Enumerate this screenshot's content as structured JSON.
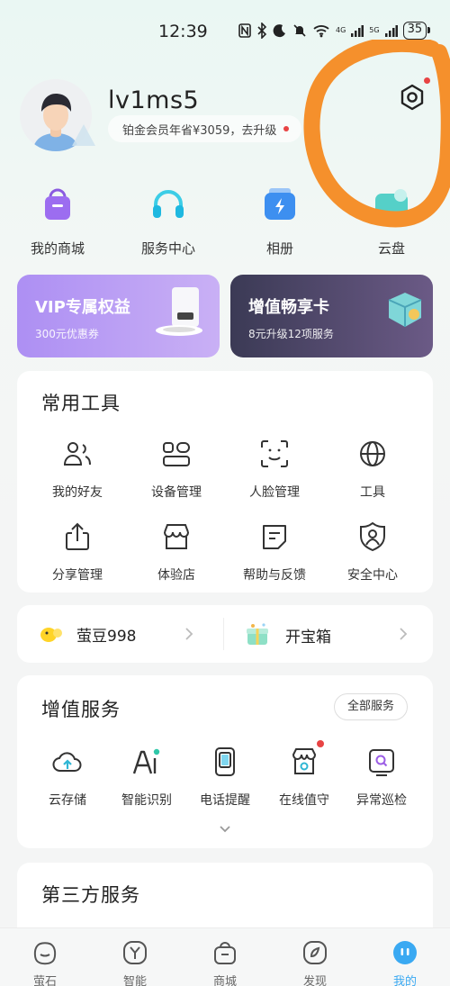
{
  "status_bar": {
    "time": "12:39",
    "net_4g": "4G",
    "net_5g": "5G",
    "battery": "35"
  },
  "profile": {
    "username": "lv1ms5",
    "member_promo": "铂金会员年省¥3059，去升级"
  },
  "quick_entries": [
    {
      "label": "我的商城",
      "icon": "shopping-bag-icon"
    },
    {
      "label": "服务中心",
      "icon": "headset-icon"
    },
    {
      "label": "相册",
      "icon": "album-icon"
    },
    {
      "label": "云盘",
      "icon": "cloud-drive-icon"
    }
  ],
  "promos": {
    "vip": {
      "title": "VIP专属权益",
      "subtitle": "300元优惠券"
    },
    "card": {
      "title": "增值畅享卡",
      "subtitle": "8元升级12项服务"
    }
  },
  "tools": {
    "title": "常用工具",
    "items": [
      {
        "label": "我的好友",
        "icon": "friends-icon"
      },
      {
        "label": "设备管理",
        "icon": "device-manage-icon"
      },
      {
        "label": "人脸管理",
        "icon": "face-icon"
      },
      {
        "label": "工具",
        "icon": "globe-icon"
      },
      {
        "label": "分享管理",
        "icon": "share-icon"
      },
      {
        "label": "体验店",
        "icon": "store-icon"
      },
      {
        "label": "帮助与反馈",
        "icon": "feedback-icon"
      },
      {
        "label": "安全中心",
        "icon": "shield-icon"
      }
    ]
  },
  "rewards": {
    "beans": "萤豆998",
    "treasure": "开宝箱"
  },
  "value_services": {
    "title": "增值服务",
    "all_button": "全部服务",
    "items": [
      {
        "label": "云存储",
        "icon": "cloud-upload-icon"
      },
      {
        "label": "智能识别",
        "icon": "ai-icon"
      },
      {
        "label": "电话提醒",
        "icon": "phone-icon"
      },
      {
        "label": "在线值守",
        "icon": "online-guard-icon"
      },
      {
        "label": "异常巡检",
        "icon": "inspect-icon"
      }
    ]
  },
  "third_party": {
    "title": "第三方服务"
  },
  "bottom_nav": [
    {
      "label": "萤石",
      "icon": "home-icon"
    },
    {
      "label": "智能",
      "icon": "smart-icon"
    },
    {
      "label": "商城",
      "icon": "mall-icon"
    },
    {
      "label": "发现",
      "icon": "discover-icon"
    },
    {
      "label": "我的",
      "icon": "me-icon",
      "active": true
    }
  ],
  "colors": {
    "accent": "#3aa9f2",
    "badge": "#e84444",
    "annotation": "#f5902c"
  }
}
